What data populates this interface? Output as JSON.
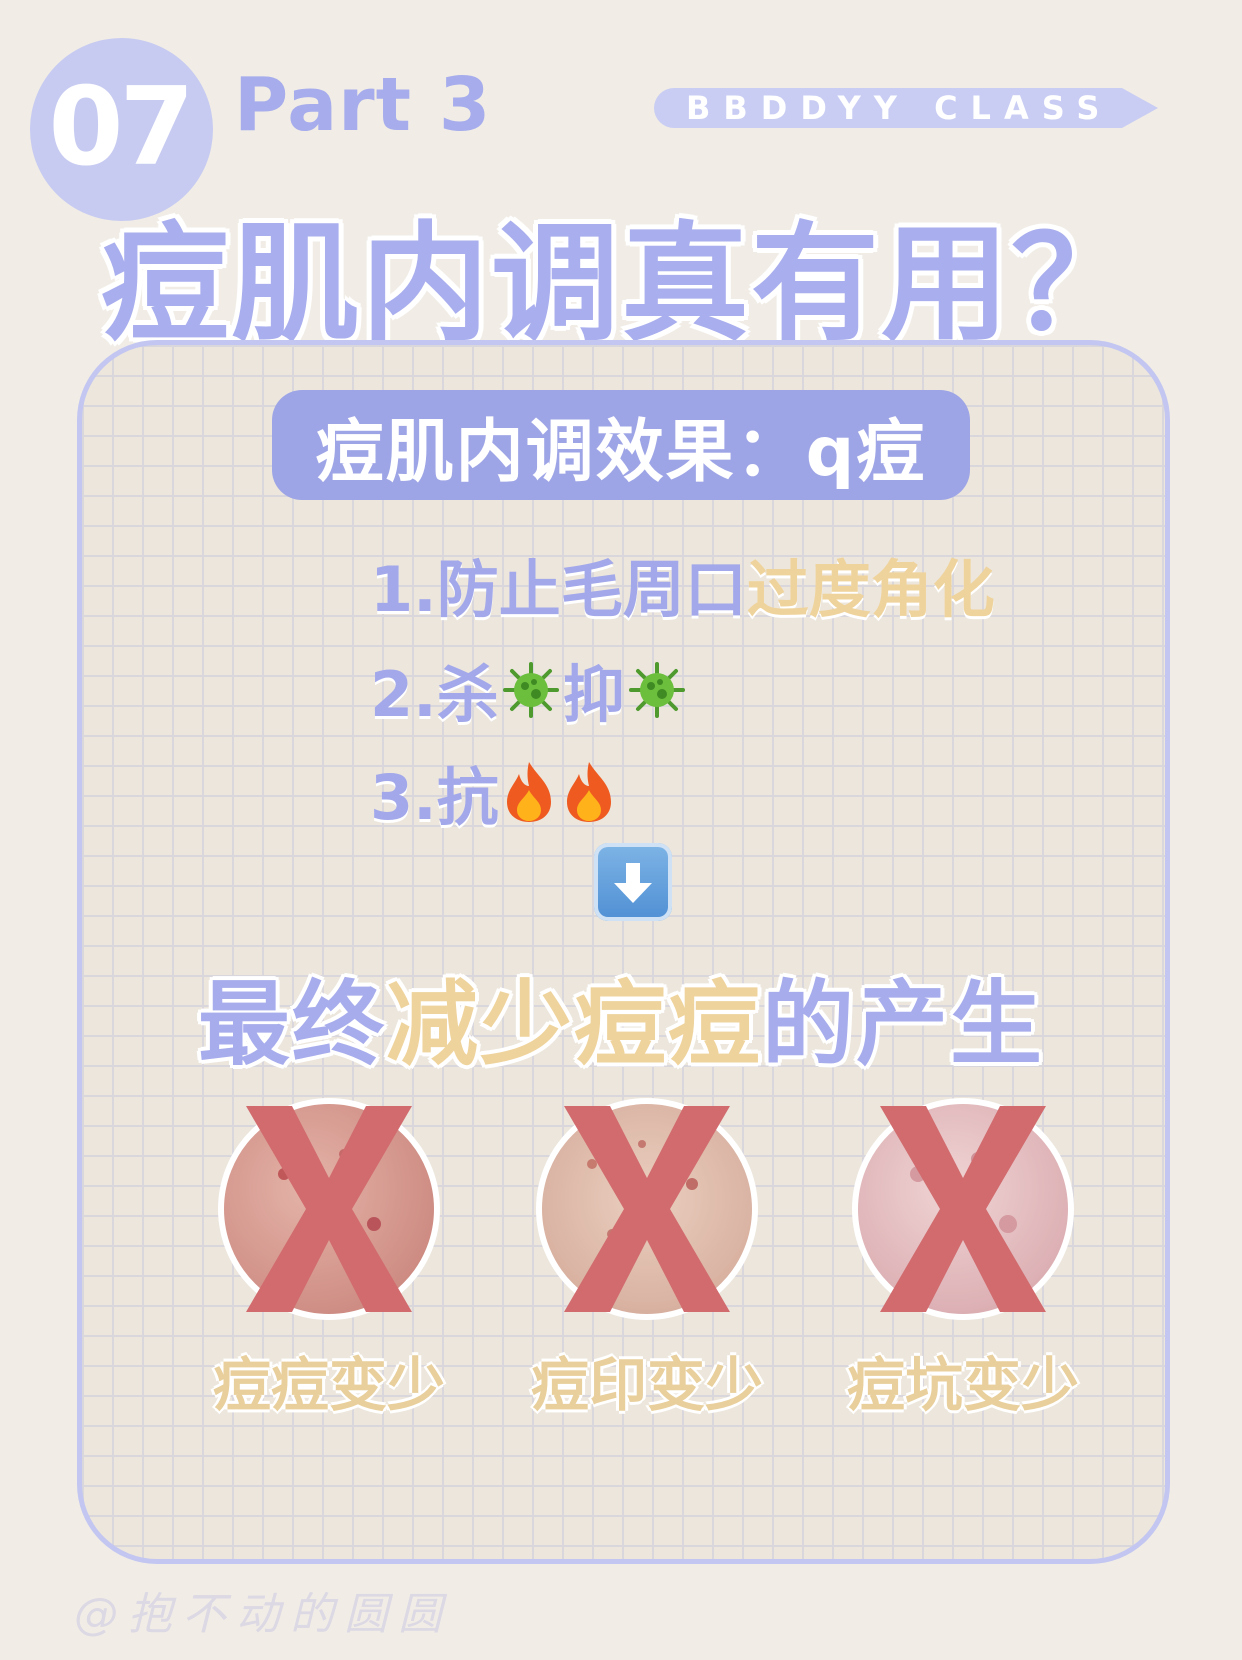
{
  "badge": {
    "number": "07"
  },
  "part": "Part 3",
  "class_tag": "BBDDYY CLASS",
  "title": "痘肌内调真有用？",
  "panel": {
    "header": "痘肌内调效果：q痘",
    "points": [
      {
        "prefix": "1.防止毛周口",
        "highlight": "过度角化"
      },
      {
        "prefix": "2.杀",
        "middle": "抑",
        "icon": "microbe-icon"
      },
      {
        "prefix": "3.抗",
        "icon": "fire-icon"
      }
    ],
    "arrow_icon": "down-arrow-icon",
    "result": {
      "before": "最终",
      "highlight": "减少痘痘",
      "after": "的产生"
    },
    "items": [
      {
        "label": "痘痘变少",
        "icon": "cross-mark-icon"
      },
      {
        "label": "痘印变少",
        "icon": "cross-mark-icon"
      },
      {
        "label": "痘坑变少",
        "icon": "cross-mark-icon"
      }
    ]
  },
  "watermark": "@抱不动的圆圆",
  "colors": {
    "background": "#f1ede6",
    "lavender": "#a6acec",
    "header_bg": "#9ea5e6",
    "gold": "#efd39c",
    "cross_red": "#d16b6e"
  }
}
